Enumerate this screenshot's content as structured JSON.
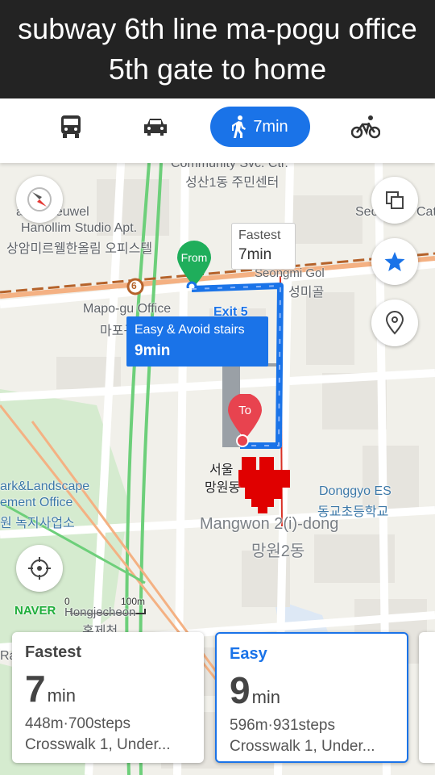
{
  "banner": {
    "line1": "subway 6th line ma-pogu office",
    "line2": "5th gate to home"
  },
  "modes": [
    {
      "icon": "bus-icon"
    },
    {
      "icon": "car-icon"
    },
    {
      "icon": "walk-icon",
      "label": "7min",
      "active": true
    },
    {
      "icon": "bike-icon"
    }
  ],
  "map": {
    "labels": {
      "community": "Community Svc. Ctr.",
      "seongsan": "성산1동 주민센터",
      "mireuwel": "am Mireuwel",
      "hanollim": "Hanollim Studio Apt.",
      "hanollim_ko": "상암미르웰한올림 오피스텔",
      "mapogu_office": "Mapo-gu Office",
      "mapogu_ko": "마포구청역",
      "seongmi_en": "Seongmi Gol",
      "seongmi_ko": "성미골",
      "seo": "Seo",
      "cat": "Cat",
      "exit": "Exit 5",
      "seoul": "서울",
      "mangwon_short": "망원동",
      "donggyo": "Donggyo ES",
      "donggyo_ko": "동교초등학교",
      "mangwon": "Mangwon 2(i)-dong",
      "mangwon_ko": "망원2동",
      "park": "ark&Landscape",
      "mgmt": "ement Office",
      "park_ko": "원 녹지사업소",
      "hongjecheon": "Hongjecheon",
      "hongjecheon_ko": "홍제천",
      "scale": "100m",
      "scale_zero": "0",
      "naver": "NAVER",
      "subway_line": "6",
      "ra": "Ra"
    },
    "pin_from": "From",
    "pin_to": "To",
    "fastest_callout": {
      "title": "Fastest",
      "time": "7min"
    },
    "easy_callout": {
      "title": "Easy & Avoid stairs",
      "time": "9min"
    },
    "route_color": "#1a73e8",
    "pin_from_color": "#1fae5b",
    "pin_to_color": "#e8434f"
  },
  "cards": [
    {
      "title": "Fastest",
      "time_num": "7",
      "time_unit": "min",
      "distance": "448m",
      "steps": "700steps",
      "summary": "Crosswalk 1, Under...",
      "selected": false
    },
    {
      "title": "Easy",
      "time_num": "9",
      "time_unit": "min",
      "distance": "596m",
      "steps": "931steps",
      "summary": "Crosswalk 1, Under...",
      "selected": true
    }
  ],
  "sep": "·"
}
